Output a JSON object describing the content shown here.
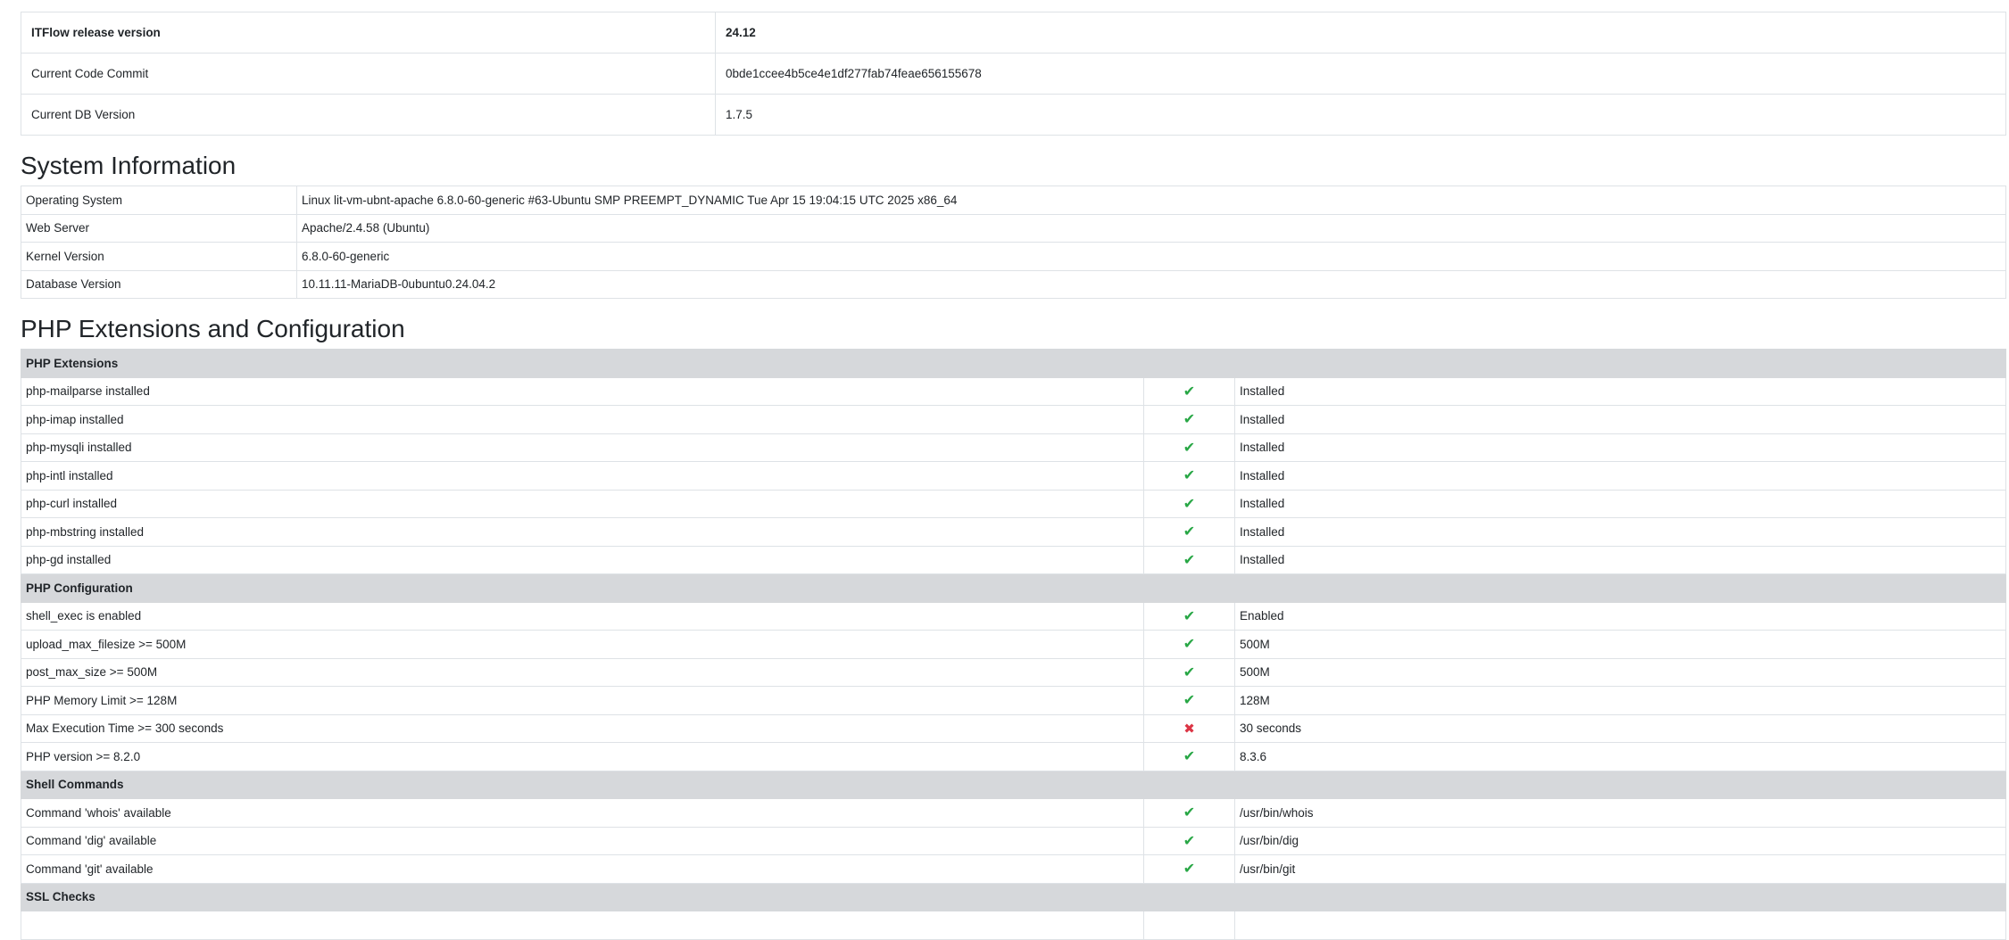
{
  "version": {
    "rows": [
      {
        "label": "ITFlow release version",
        "value": "24.12"
      },
      {
        "label": "Current Code Commit",
        "value": "0bde1ccee4b5ce4e1df277fab74feae656155678"
      },
      {
        "label": "Current DB Version",
        "value": "1.7.5"
      }
    ]
  },
  "system": {
    "title": "System Information",
    "rows": [
      {
        "label": "Operating System",
        "value": "Linux lit-vm-ubnt-apache 6.8.0-60-generic #63-Ubuntu SMP PREEMPT_DYNAMIC Tue Apr 15 19:04:15 UTC 2025 x86_64"
      },
      {
        "label": "Web Server",
        "value": "Apache/2.4.58 (Ubuntu)"
      },
      {
        "label": "Kernel Version",
        "value": "6.8.0-60-generic"
      },
      {
        "label": "Database Version",
        "value": "10.11.11-MariaDB-0ubuntu0.24.04.2"
      }
    ]
  },
  "php": {
    "title": "PHP Extensions and Configuration",
    "sections": [
      {
        "name": "PHP Extensions",
        "rows": [
          {
            "label": "php-mailparse installed",
            "status": "check-icon",
            "value": "Installed"
          },
          {
            "label": "php-imap installed",
            "status": "check-icon",
            "value": "Installed"
          },
          {
            "label": "php-mysqli installed",
            "status": "check-icon",
            "value": "Installed"
          },
          {
            "label": "php-intl installed",
            "status": "check-icon",
            "value": "Installed"
          },
          {
            "label": "php-curl installed",
            "status": "check-icon",
            "value": "Installed"
          },
          {
            "label": "php-mbstring installed",
            "status": "check-icon",
            "value": "Installed"
          },
          {
            "label": "php-gd installed",
            "status": "check-icon",
            "value": "Installed"
          }
        ]
      },
      {
        "name": "PHP Configuration",
        "rows": [
          {
            "label": "shell_exec is enabled",
            "status": "check-icon",
            "value": "Enabled"
          },
          {
            "label": "upload_max_filesize >= 500M",
            "status": "check-icon",
            "value": "500M"
          },
          {
            "label": "post_max_size >= 500M",
            "status": "check-icon",
            "value": "500M"
          },
          {
            "label": "PHP Memory Limit >= 128M",
            "status": "check-icon",
            "value": "128M"
          },
          {
            "label": "Max Execution Time >= 300 seconds",
            "status": "cross-icon",
            "value": "30 seconds"
          },
          {
            "label": "PHP version >= 8.2.0",
            "status": "check-icon",
            "value": "8.3.6"
          }
        ]
      },
      {
        "name": "Shell Commands",
        "rows": [
          {
            "label": "Command 'whois' available",
            "status": "check-icon",
            "value": "/usr/bin/whois"
          },
          {
            "label": "Command 'dig' available",
            "status": "check-icon",
            "value": "/usr/bin/dig"
          },
          {
            "label": "Command 'git' available",
            "status": "check-icon",
            "value": "/usr/bin/git"
          }
        ]
      },
      {
        "name": "SSL Checks",
        "rows": [
          {
            "label": "",
            "status": "",
            "value": ""
          }
        ]
      }
    ]
  },
  "colors": {
    "check": "#28a745",
    "cross": "#dc3545",
    "section_bg": "#d6d8db"
  }
}
